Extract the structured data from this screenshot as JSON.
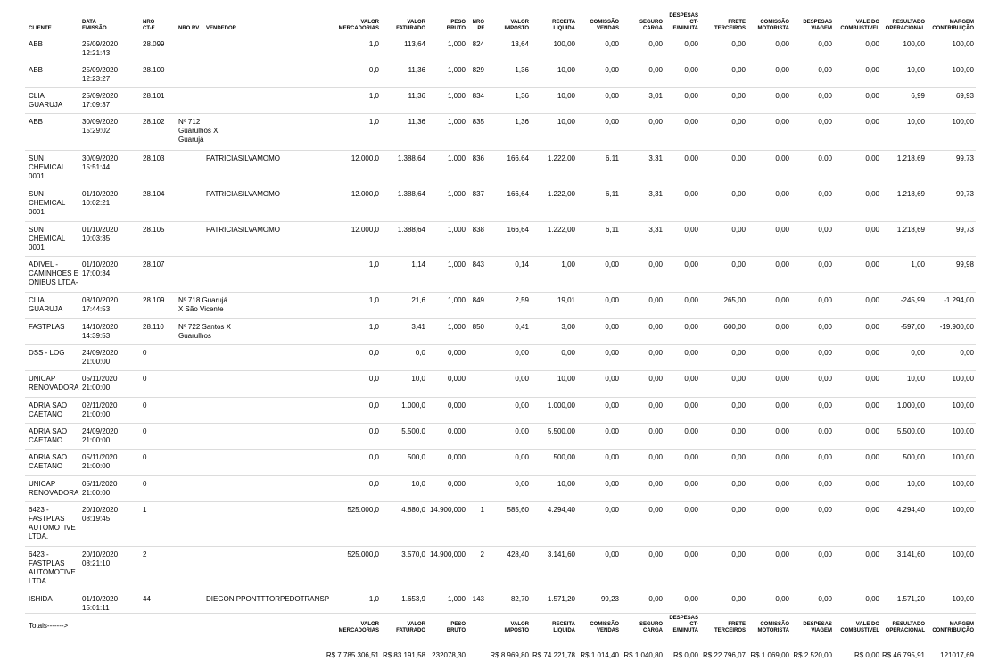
{
  "columns": [
    {
      "key": "cliente",
      "label": "CLIENTE"
    },
    {
      "key": "data",
      "label": "DATA EMISSÃO"
    },
    {
      "key": "cte",
      "label": "NRO CT-E"
    },
    {
      "key": "rv",
      "label": "NRO RV"
    },
    {
      "key": "vendedor",
      "label": "VENDEDOR"
    },
    {
      "key": "vmerc",
      "label": "VALOR MERCADORIAS"
    },
    {
      "key": "vfat",
      "label": "VALOR FATURADO"
    },
    {
      "key": "peso",
      "label": "PESO BRUTO"
    },
    {
      "key": "pf",
      "label": "NRO PF"
    },
    {
      "key": "vimp",
      "label": "VALOR IMPOSTO"
    },
    {
      "key": "rec",
      "label": "RECEITA LIQUIDA"
    },
    {
      "key": "com",
      "label": "COMISSÃO VENDAS"
    },
    {
      "key": "seg",
      "label": "SEGURO CARGA"
    },
    {
      "key": "desp",
      "label": "DESPESAS CT-E/MINUTA"
    },
    {
      "key": "frete",
      "label": "FRETE TERCEIROS"
    },
    {
      "key": "comm",
      "label": "COMISSÃO MOTORISTA"
    },
    {
      "key": "dv",
      "label": "DESPESAS VIAGEM"
    },
    {
      "key": "vale",
      "label": "VALE DO COMBUSTIVEL"
    },
    {
      "key": "res",
      "label": "RESULTADO OPERACIONAL"
    },
    {
      "key": "mar",
      "label": "MARGEM CONTRIBUIÇÃO"
    }
  ],
  "rows": [
    {
      "cliente": [
        "ABB"
      ],
      "data": [
        "25/09/2020",
        "12:21:43"
      ],
      "cte": "28.099",
      "rv": [],
      "vendedor": "",
      "vmerc": "1,0",
      "vfat": "113,64",
      "peso": "1,000",
      "pf": "824",
      "vimp": "13,64",
      "rec": "100,00",
      "com": "0,00",
      "seg": "0,00",
      "desp": "0,00",
      "frete": "0,00",
      "comm": "0,00",
      "dv": "0,00",
      "vale": "0,00",
      "res": "100,00",
      "mar": "100,00"
    },
    {
      "cliente": [
        "ABB"
      ],
      "data": [
        "25/09/2020",
        "12:23:27"
      ],
      "cte": "28.100",
      "rv": [],
      "vendedor": "",
      "vmerc": "0,0",
      "vfat": "11,36",
      "peso": "1,000",
      "pf": "829",
      "vimp": "1,36",
      "rec": "10,00",
      "com": "0,00",
      "seg": "0,00",
      "desp": "0,00",
      "frete": "0,00",
      "comm": "0,00",
      "dv": "0,00",
      "vale": "0,00",
      "res": "10,00",
      "mar": "100,00"
    },
    {
      "cliente": [
        "CLIA",
        "GUARUJA"
      ],
      "data": [
        "25/09/2020",
        "17:09:37"
      ],
      "cte": "28.101",
      "rv": [],
      "vendedor": "",
      "vmerc": "1,0",
      "vfat": "11,36",
      "peso": "1,000",
      "pf": "834",
      "vimp": "1,36",
      "rec": "10,00",
      "com": "0,00",
      "seg": "3,01",
      "desp": "0,00",
      "frete": "0,00",
      "comm": "0,00",
      "dv": "0,00",
      "vale": "0,00",
      "res": "6,99",
      "mar": "69,93"
    },
    {
      "cliente": [
        "ABB"
      ],
      "data": [
        "30/09/2020",
        "15:29:02"
      ],
      "cte": "28.102",
      "rv": [
        "Nº 712",
        "Guarulhos X",
        "Guarujá"
      ],
      "vendedor": "",
      "vmerc": "1,0",
      "vfat": "11,36",
      "peso": "1,000",
      "pf": "835",
      "vimp": "1,36",
      "rec": "10,00",
      "com": "0,00",
      "seg": "0,00",
      "desp": "0,00",
      "frete": "0,00",
      "comm": "0,00",
      "dv": "0,00",
      "vale": "0,00",
      "res": "10,00",
      "mar": "100,00"
    },
    {
      "cliente": [
        "SUN",
        "CHEMICAL",
        "0001"
      ],
      "data": [
        "30/09/2020",
        "15:51:44"
      ],
      "cte": "28.103",
      "rv": [],
      "vendedor": "PATRICIASILVAMOMO",
      "vmerc": "12.000,0",
      "vfat": "1.388,64",
      "peso": "1,000",
      "pf": "836",
      "vimp": "166,64",
      "rec": "1.222,00",
      "com": "6,11",
      "seg": "3,31",
      "desp": "0,00",
      "frete": "0,00",
      "comm": "0,00",
      "dv": "0,00",
      "vale": "0,00",
      "res": "1.218,69",
      "mar": "99,73"
    },
    {
      "cliente": [
        "SUN",
        "CHEMICAL",
        "0001"
      ],
      "data": [
        "01/10/2020",
        "10:02:21"
      ],
      "cte": "28.104",
      "rv": [],
      "vendedor": "PATRICIASILVAMOMO",
      "vmerc": "12.000,0",
      "vfat": "1.388,64",
      "peso": "1,000",
      "pf": "837",
      "vimp": "166,64",
      "rec": "1.222,00",
      "com": "6,11",
      "seg": "3,31",
      "desp": "0,00",
      "frete": "0,00",
      "comm": "0,00",
      "dv": "0,00",
      "vale": "0,00",
      "res": "1.218,69",
      "mar": "99,73"
    },
    {
      "cliente": [
        "SUN",
        "CHEMICAL",
        "0001"
      ],
      "data": [
        "01/10/2020",
        "10:03:35"
      ],
      "cte": "28.105",
      "rv": [],
      "vendedor": "PATRICIASILVAMOMO",
      "vmerc": "12.000,0",
      "vfat": "1.388,64",
      "peso": "1,000",
      "pf": "838",
      "vimp": "166,64",
      "rec": "1.222,00",
      "com": "6,11",
      "seg": "3,31",
      "desp": "0,00",
      "frete": "0,00",
      "comm": "0,00",
      "dv": "0,00",
      "vale": "0,00",
      "res": "1.218,69",
      "mar": "99,73"
    },
    {
      "cliente": [
        "ADIVEL -",
        "CAMINHOES E",
        "ONIBUS LTDA-"
      ],
      "data": [
        "01/10/2020",
        "17:00:34"
      ],
      "cte": "28.107",
      "rv": [],
      "vendedor": "",
      "vmerc": "1,0",
      "vfat": "1,14",
      "peso": "1,000",
      "pf": "843",
      "vimp": "0,14",
      "rec": "1,00",
      "com": "0,00",
      "seg": "0,00",
      "desp": "0,00",
      "frete": "0,00",
      "comm": "0,00",
      "dv": "0,00",
      "vale": "0,00",
      "res": "1,00",
      "mar": "99,98"
    },
    {
      "cliente": [
        "CLIA",
        "GUARUJA"
      ],
      "data": [
        "08/10/2020",
        "17:44:53"
      ],
      "cte": "28.109",
      "rv": [
        "Nº 718 Guarujá",
        "X São Vicente"
      ],
      "vendedor": "",
      "vmerc": "1,0",
      "vfat": "21,6",
      "peso": "1,000",
      "pf": "849",
      "vimp": "2,59",
      "rec": "19,01",
      "com": "0,00",
      "seg": "0,00",
      "desp": "0,00",
      "frete": "265,00",
      "comm": "0,00",
      "dv": "0,00",
      "vale": "0,00",
      "res": "-245,99",
      "mar": "-1.294,00"
    },
    {
      "cliente": [
        "FASTPLAS"
      ],
      "data": [
        "14/10/2020",
        "14:39:53"
      ],
      "cte": "28.110",
      "rv": [
        "Nº 722 Santos X",
        "Guarulhos"
      ],
      "vendedor": "",
      "vmerc": "1,0",
      "vfat": "3,41",
      "peso": "1,000",
      "pf": "850",
      "vimp": "0,41",
      "rec": "3,00",
      "com": "0,00",
      "seg": "0,00",
      "desp": "0,00",
      "frete": "600,00",
      "comm": "0,00",
      "dv": "0,00",
      "vale": "0,00",
      "res": "-597,00",
      "mar": "-19.900,00"
    },
    {
      "cliente": [
        "DSS - LOG"
      ],
      "data": [
        "24/09/2020",
        "21:00:00"
      ],
      "cte": "0",
      "rv": [],
      "vendedor": "",
      "vmerc": "0,0",
      "vfat": "0,0",
      "peso": "0,000",
      "pf": "",
      "vimp": "0,00",
      "rec": "0,00",
      "com": "0,00",
      "seg": "0,00",
      "desp": "0,00",
      "frete": "0,00",
      "comm": "0,00",
      "dv": "0,00",
      "vale": "0,00",
      "res": "0,00",
      "mar": "0,00"
    },
    {
      "cliente": [
        "UNICAP",
        "RENOVADORA"
      ],
      "data": [
        "05/11/2020",
        "21:00:00"
      ],
      "cte": "0",
      "rv": [],
      "vendedor": "",
      "vmerc": "0,0",
      "vfat": "10,0",
      "peso": "0,000",
      "pf": "",
      "vimp": "0,00",
      "rec": "10,00",
      "com": "0,00",
      "seg": "0,00",
      "desp": "0,00",
      "frete": "0,00",
      "comm": "0,00",
      "dv": "0,00",
      "vale": "0,00",
      "res": "10,00",
      "mar": "100,00"
    },
    {
      "cliente": [
        "ADRIA SAO",
        "CAETANO"
      ],
      "data": [
        "02/11/2020",
        "21:00:00"
      ],
      "cte": "0",
      "rv": [],
      "vendedor": "",
      "vmerc": "0,0",
      "vfat": "1.000,0",
      "peso": "0,000",
      "pf": "",
      "vimp": "0,00",
      "rec": "1.000,00",
      "com": "0,00",
      "seg": "0,00",
      "desp": "0,00",
      "frete": "0,00",
      "comm": "0,00",
      "dv": "0,00",
      "vale": "0,00",
      "res": "1.000,00",
      "mar": "100,00"
    },
    {
      "cliente": [
        "ADRIA SAO",
        "CAETANO"
      ],
      "data": [
        "24/09/2020",
        "21:00:00"
      ],
      "cte": "0",
      "rv": [],
      "vendedor": "",
      "vmerc": "0,0",
      "vfat": "5.500,0",
      "peso": "0,000",
      "pf": "",
      "vimp": "0,00",
      "rec": "5.500,00",
      "com": "0,00",
      "seg": "0,00",
      "desp": "0,00",
      "frete": "0,00",
      "comm": "0,00",
      "dv": "0,00",
      "vale": "0,00",
      "res": "5.500,00",
      "mar": "100,00"
    },
    {
      "cliente": [
        "ADRIA SAO",
        "CAETANO"
      ],
      "data": [
        "05/11/2020",
        "21:00:00"
      ],
      "cte": "0",
      "rv": [],
      "vendedor": "",
      "vmerc": "0,0",
      "vfat": "500,0",
      "peso": "0,000",
      "pf": "",
      "vimp": "0,00",
      "rec": "500,00",
      "com": "0,00",
      "seg": "0,00",
      "desp": "0,00",
      "frete": "0,00",
      "comm": "0,00",
      "dv": "0,00",
      "vale": "0,00",
      "res": "500,00",
      "mar": "100,00"
    },
    {
      "cliente": [
        "UNICAP",
        "RENOVADORA"
      ],
      "data": [
        "05/11/2020",
        "21:00:00"
      ],
      "cte": "0",
      "rv": [],
      "vendedor": "",
      "vmerc": "0,0",
      "vfat": "10,0",
      "peso": "0,000",
      "pf": "",
      "vimp": "0,00",
      "rec": "10,00",
      "com": "0,00",
      "seg": "0,00",
      "desp": "0,00",
      "frete": "0,00",
      "comm": "0,00",
      "dv": "0,00",
      "vale": "0,00",
      "res": "10,00",
      "mar": "100,00"
    },
    {
      "cliente": [
        "6423 -",
        "FASTPLAS",
        "AUTOMOTIVE",
        "LTDA."
      ],
      "data": [
        "20/10/2020",
        "08:19:45"
      ],
      "cte": "1",
      "rv": [],
      "vendedor": "",
      "vmerc": "525.000,0",
      "vfat": "4.880,0",
      "peso": "14.900,000",
      "pf": "1",
      "vimp": "585,60",
      "rec": "4.294,40",
      "com": "0,00",
      "seg": "0,00",
      "desp": "0,00",
      "frete": "0,00",
      "comm": "0,00",
      "dv": "0,00",
      "vale": "0,00",
      "res": "4.294,40",
      "mar": "100,00"
    },
    {
      "cliente": [
        "6423 -",
        "FASTPLAS",
        "AUTOMOTIVE",
        "LTDA."
      ],
      "data": [
        "20/10/2020",
        "08:21:10"
      ],
      "cte": "2",
      "rv": [],
      "vendedor": "",
      "vmerc": "525.000,0",
      "vfat": "3.570,0",
      "peso": "14.900,000",
      "pf": "2",
      "vimp": "428,40",
      "rec": "3.141,60",
      "com": "0,00",
      "seg": "0,00",
      "desp": "0,00",
      "frete": "0,00",
      "comm": "0,00",
      "dv": "0,00",
      "vale": "0,00",
      "res": "3.141,60",
      "mar": "100,00"
    },
    {
      "cliente": [
        "ISHIDA"
      ],
      "data": [
        "01/10/2020",
        "15:01:11"
      ],
      "cte": "44",
      "rv": [],
      "vendedor": "DIEGONIPPONTTTORPEDOTRANSP",
      "vmerc": "1,0",
      "vfat": "1.653,9",
      "peso": "1,000",
      "pf": "143",
      "vimp": "82,70",
      "rec": "1.571,20",
      "com": "99,23",
      "seg": "0,00",
      "desp": "0,00",
      "frete": "0,00",
      "comm": "0,00",
      "dv": "0,00",
      "vale": "0,00",
      "res": "1.571,20",
      "mar": "100,00"
    }
  ],
  "totals": {
    "label": "Totais------->",
    "headers": [
      {
        "key": "vmerc",
        "label": "VALOR MERCADORIAS"
      },
      {
        "key": "vfat",
        "label": "VALOR FATURADO"
      },
      {
        "key": "peso",
        "label": "PESO BRUTO"
      },
      {
        "key": "vimp",
        "label": "VALOR IMPOSTO"
      },
      {
        "key": "rec",
        "label": "RECEITA LIQUIDA"
      },
      {
        "key": "com",
        "label": "COMISSÃO VENDAS"
      },
      {
        "key": "seg",
        "label": "SEGURO CARGA"
      },
      {
        "key": "desp",
        "label": "DESPESAS CT-E/MINUTA"
      },
      {
        "key": "frete",
        "label": "FRETE TERCEIROS"
      },
      {
        "key": "comm",
        "label": "COMISSÃO MOTORISTA"
      },
      {
        "key": "dv",
        "label": "DESPESAS VIAGEM"
      },
      {
        "key": "vale",
        "label": "VALE DO COMBUSTIVEL"
      },
      {
        "key": "res",
        "label": "RESULTADO OPERACIONAL"
      },
      {
        "key": "mar",
        "label": "MARGEM CONTRIBUIÇÃO"
      }
    ],
    "values": {
      "vmerc": "R$ 7.785.306,51",
      "vfat": "R$ 83.191,58",
      "peso": "232078,30",
      "vimp": "R$ 8.969,80",
      "rec": "R$ 74.221,78",
      "com": "R$ 1.014,40",
      "seg": "R$ 1.040,80",
      "desp": "R$ 0,00",
      "frete": "R$ 22.796,07",
      "comm": "R$ 1.069,00",
      "dv": "R$ 2.520,00",
      "vale": "R$ 0,00",
      "res": "R$ 46.795,91",
      "mar": "121017,69"
    }
  }
}
